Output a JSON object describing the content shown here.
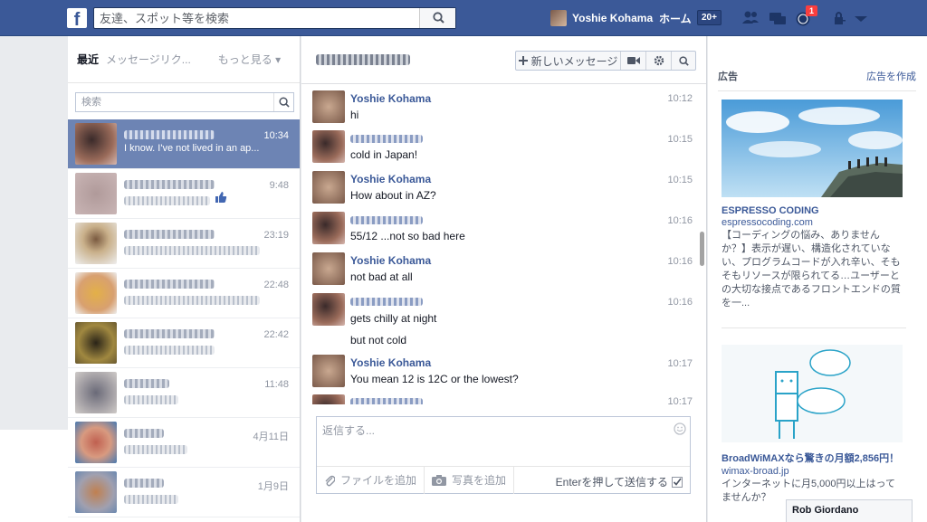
{
  "topbar": {
    "logo": "f",
    "search_placeholder": "友達、スポット等を検索",
    "user_name": "Yoshie Kohama",
    "home_label": "ホーム",
    "home_badge": "20+",
    "notification_count": "1"
  },
  "left": {
    "tabs": [
      "最近",
      "メッセージリク...",
      "もっと見る ▾"
    ],
    "search_placeholder": "検索",
    "conversations": [
      {
        "time": "10:34",
        "snippet": "I know. I've not lived in an ap...",
        "active": true
      },
      {
        "time": "9:48",
        "snippet": "",
        "active": false
      },
      {
        "time": "23:19",
        "snippet": "",
        "active": false
      },
      {
        "time": "22:48",
        "snippet": "",
        "active": false
      },
      {
        "time": "22:42",
        "snippet": "",
        "active": false
      },
      {
        "time": "11:48",
        "snippet": "",
        "active": false
      },
      {
        "time": "4月11日",
        "snippet": "",
        "active": false
      },
      {
        "time": "1月9日",
        "snippet": "",
        "active": false
      }
    ]
  },
  "middle": {
    "new_message_label": "新しいメッセージ",
    "messages": [
      {
        "sender": "Yoshie Kohama",
        "text": "hi",
        "time": "10:12",
        "self": true
      },
      {
        "sender": "",
        "text": "cold in Japan!",
        "time": "10:15",
        "self": false
      },
      {
        "sender": "Yoshie Kohama",
        "text": "How about in AZ?",
        "time": "10:15",
        "self": true
      },
      {
        "sender": "",
        "text": "55/12 ...not so bad here",
        "time": "10:16",
        "self": false
      },
      {
        "sender": "Yoshie Kohama",
        "text": "not bad at all",
        "time": "10:16",
        "self": true
      },
      {
        "sender": "",
        "text": "gets chilly at night",
        "text2": "but not cold",
        "time": "10:16",
        "self": false
      },
      {
        "sender": "Yoshie Kohama",
        "text": "You mean 12 is 12C or the lowest?",
        "time": "10:17",
        "self": true
      },
      {
        "sender": "",
        "text": "",
        "time": "10:17",
        "self": false
      }
    ],
    "compose_placeholder": "返信する...",
    "attach_file_label": "ファイルを追加",
    "add_photo_label": "写真を追加",
    "enter_send_label": "Enterを押して送信する"
  },
  "right": {
    "ads_label": "広告",
    "create_ad_label": "広告を作成",
    "ads": [
      {
        "title": "ESPRESSO CODING",
        "domain": "espressocoding.com",
        "body": "【コーディングの悩み、ありませんか？】表示が遅い、構造化されていない、プログラムコードが入れ辛い、そもそもリソースが限られてる…ユーザーとの大切な接点であるフロントエンドの質を一..."
      },
      {
        "title": "BroadWiMAXなら驚きの月額2,856円！",
        "domain": "wimax-broad.jp",
        "body": "インターネットに月5,000円以上はってませんか？"
      }
    ]
  },
  "chat_tab": {
    "name": "Rob Giordano"
  },
  "colors": {
    "brand": "#3b5998",
    "active_row": "#6d84b4",
    "badge": "#fa3e3e"
  }
}
